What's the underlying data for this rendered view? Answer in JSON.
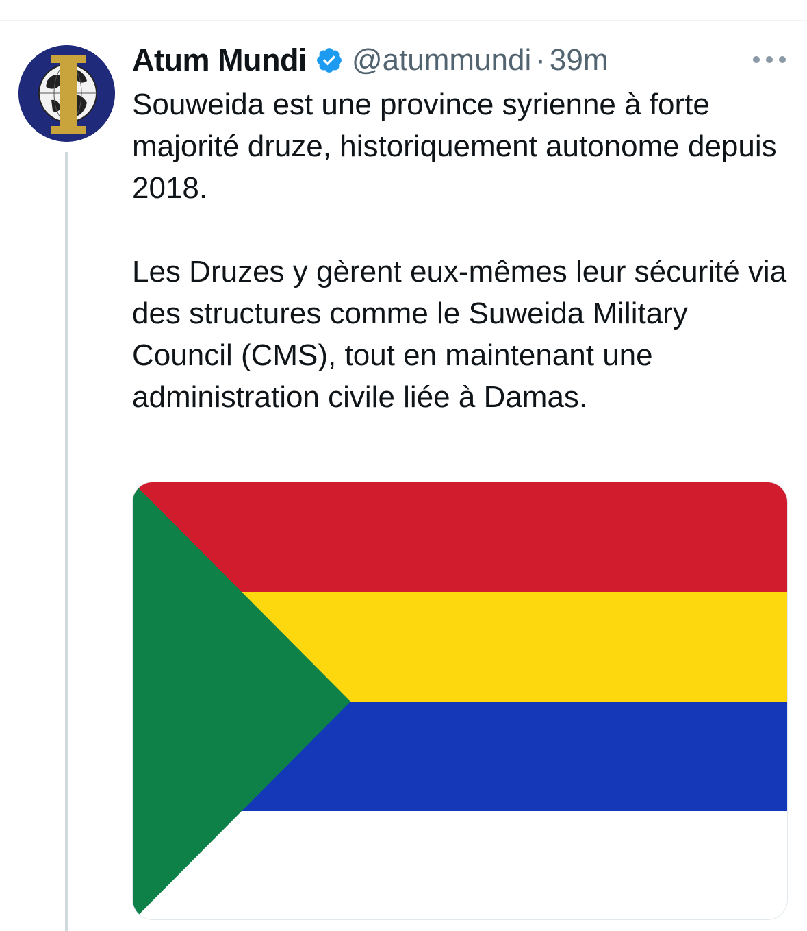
{
  "tweet": {
    "display_name": "Atum Mundi",
    "handle": "@atummundi",
    "separator": "·",
    "timestamp": "39m",
    "verified_icon": "verified-badge-icon",
    "more_icon": "more-options-icon",
    "paragraphs": [
      "Souweida est une province syrienne à forte majorité druze, historiquement autonome depuis 2018.",
      "Les Druzes y gèrent eux-mêmes leur sécurité via des structures comme le Suweida Military Council (CMS), tout en maintenant une administration civile liée à Damas."
    ],
    "media": {
      "kind": "druze-flag-image",
      "stripe_colors": [
        "#d11c2e",
        "#fdd80e",
        "#1438b8",
        "#ffffff"
      ],
      "triangle_color": "#0e8148"
    }
  },
  "colors": {
    "verified_blue": "#1d9bf0",
    "secondary_text": "#536471",
    "thread_line": "#cfd9de"
  }
}
